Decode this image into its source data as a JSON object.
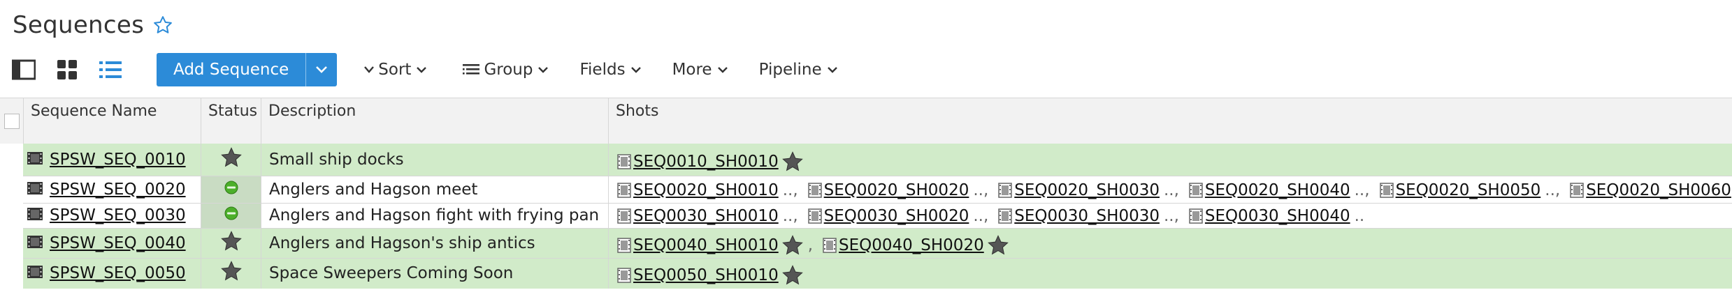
{
  "page": {
    "title": "Sequences"
  },
  "toolbar": {
    "add_label": "Add Sequence",
    "menus": [
      "Sort",
      "Group",
      "Fields",
      "More",
      "Pipeline"
    ]
  },
  "colors": {
    "accent": "#2c8bd8",
    "row_green": "#d1ebc9",
    "status_green": "#4caf2a"
  },
  "table": {
    "columns": [
      "Sequence Name",
      "Status",
      "Description",
      "Shots"
    ],
    "rows": [
      {
        "name": "SPSW_SEQ_0010",
        "status": "star-icon",
        "description": "Small ship docks",
        "shots": [
          "SEQ0010_SH0010"
        ]
      },
      {
        "name": "SPSW_SEQ_0020",
        "status": "green-dot-icon",
        "description": "Anglers and Hagson meet",
        "shots": [
          "SEQ0020_SH0010",
          "SEQ0020_SH0020",
          "SEQ0020_SH0030",
          "SEQ0020_SH0040",
          "SEQ0020_SH0050",
          "SEQ0020_SH0060"
        ]
      },
      {
        "name": "SPSW_SEQ_0030",
        "status": "green-dot-icon",
        "description": "Anglers and Hagson fight with frying pan",
        "shots": [
          "SEQ0030_SH0010",
          "SEQ0030_SH0020",
          "SEQ0030_SH0030",
          "SEQ0030_SH0040"
        ]
      },
      {
        "name": "SPSW_SEQ_0040",
        "status": "star-icon",
        "description": "Anglers and Hagson's ship antics",
        "shots": [
          "SEQ0040_SH0010",
          "SEQ0040_SH0020"
        ]
      },
      {
        "name": "SPSW_SEQ_0050",
        "status": "star-icon",
        "description": "Space Sweepers Coming Soon",
        "shots": [
          "SEQ0050_SH0010"
        ]
      }
    ]
  }
}
